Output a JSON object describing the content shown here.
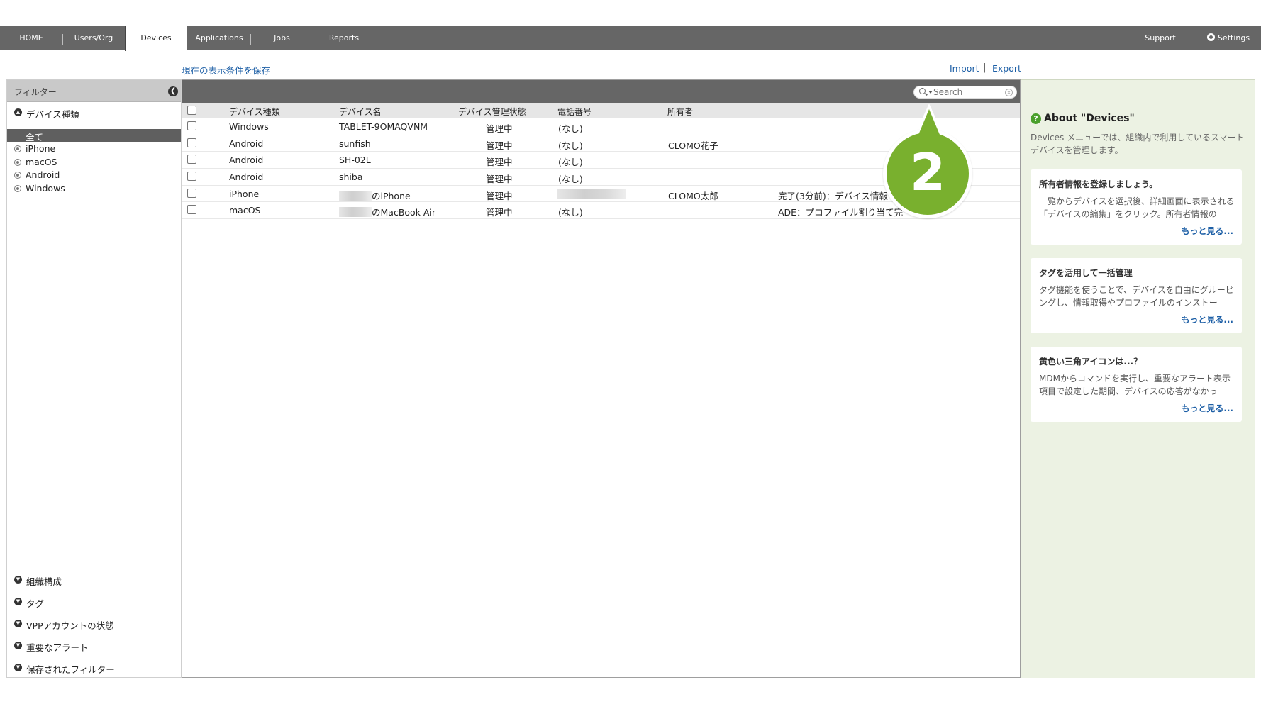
{
  "nav": {
    "tabs": [
      {
        "label": "HOME"
      },
      {
        "label": "Users/Org"
      },
      {
        "label": "Devices"
      },
      {
        "label": "Applications"
      },
      {
        "label": "Jobs"
      },
      {
        "label": "Reports"
      }
    ],
    "support": "Support",
    "settings": "Settings"
  },
  "actions": {
    "save_view": "現在の表示条件を保存",
    "import": "Import",
    "separator": "|",
    "export": "Export"
  },
  "filter": {
    "title": "フィルター",
    "device_type_section": "デバイス種類",
    "device_types": [
      {
        "label": "全て"
      },
      {
        "label": "iPhone"
      },
      {
        "label": "macOS"
      },
      {
        "label": "Android"
      },
      {
        "label": "Windows"
      }
    ],
    "bottom_sections": [
      {
        "label": "組織構成"
      },
      {
        "label": "タグ"
      },
      {
        "label": "VPPアカウントの状態"
      },
      {
        "label": "重要なアラート"
      },
      {
        "label": "保存されたフィルター"
      }
    ]
  },
  "search": {
    "placeholder": "Search"
  },
  "table": {
    "headers": [
      "デバイス種類",
      "デバイス名",
      "デバイス管理状態",
      "電話番号",
      "所有者"
    ],
    "rows": [
      {
        "type": "Windows",
        "name": "TABLET-9OMAQVNM",
        "status": "管理中",
        "phone": "(なし)",
        "owner": "",
        "note": ""
      },
      {
        "type": "Android",
        "name": "sunfish",
        "status": "管理中",
        "phone": "(なし)",
        "owner": "CLOMO花子",
        "note": ""
      },
      {
        "type": "Android",
        "name": "SH-02L",
        "status": "管理中",
        "phone": "(なし)",
        "owner": "",
        "note": ""
      },
      {
        "type": "Android",
        "name": "shiba",
        "status": "管理中",
        "phone": "(なし)",
        "owner": "",
        "note": ""
      },
      {
        "type": "iPhone",
        "name": "のiPhone",
        "status": "管理中",
        "phone": "",
        "owner": "CLOMO太郎",
        "note": "完了(3分前)：デバイス情報"
      },
      {
        "type": "macOS",
        "name": "のMacBook Air",
        "status": "管理中",
        "phone": "(なし)",
        "owner": "",
        "note": "ADE：プロファイル割り当て完"
      }
    ]
  },
  "help": {
    "title": "About \"Devices\"",
    "description": "Devices メニューでは、組織内で利用しているスマートデバイスを管理します。",
    "cards": [
      {
        "title": "所有者情報を登録しましょう。",
        "body": "一覧からデバイスを選択後、詳細画面に表示される「デバイスの編集」をクリック。所有者情報の",
        "more": "もっと見る..."
      },
      {
        "title": "タグを活用して一括管理",
        "body": "タグ機能を使うことで、デバイスを自由にグルーピングし、情報取得やプロファイルのインストー",
        "more": "もっと見る..."
      },
      {
        "title": "黄色い三角アイコンは...？",
        "body": "MDMからコマンドを実行し、重要なアラート表示項目で設定した期間、デバイスの応答がなかっ",
        "more": "もっと見る..."
      }
    ]
  },
  "callout": {
    "number": "2"
  },
  "colors": {
    "accent_green": "#79b02e",
    "nav_bg": "#666666",
    "link": "#1d5fa6"
  }
}
